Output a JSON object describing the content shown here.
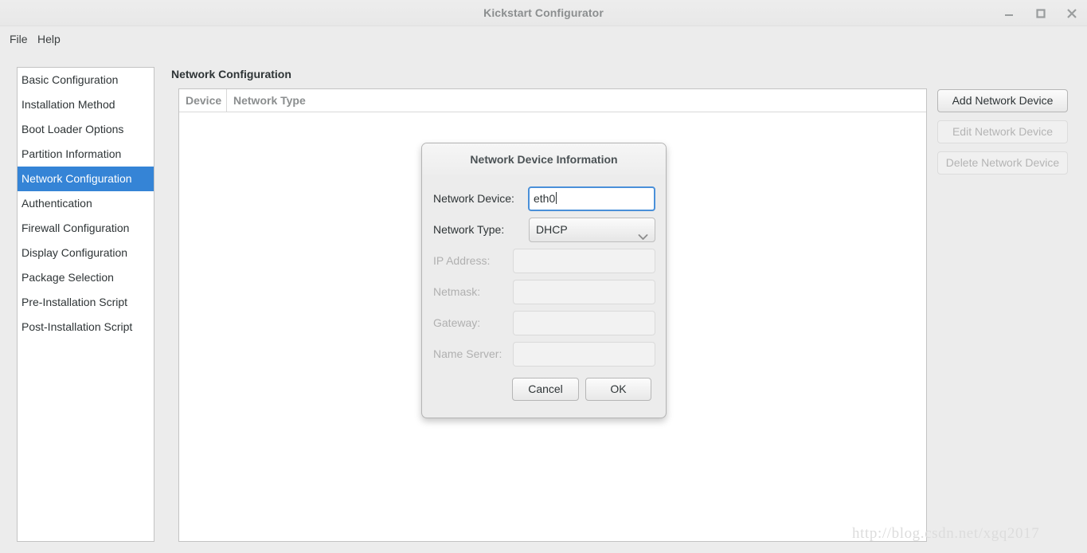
{
  "window": {
    "title": "Kickstart Configurator",
    "controls": {
      "minimize": "minimize-icon",
      "maximize": "maximize-icon",
      "close": "close-icon"
    }
  },
  "menubar": {
    "items": [
      {
        "label": "File"
      },
      {
        "label": "Help"
      }
    ]
  },
  "sidebar": {
    "items": [
      {
        "label": "Basic Configuration",
        "selected": false
      },
      {
        "label": "Installation Method",
        "selected": false
      },
      {
        "label": "Boot Loader Options",
        "selected": false
      },
      {
        "label": "Partition Information",
        "selected": false
      },
      {
        "label": "Network Configuration",
        "selected": true
      },
      {
        "label": "Authentication",
        "selected": false
      },
      {
        "label": "Firewall Configuration",
        "selected": false
      },
      {
        "label": "Display Configuration",
        "selected": false
      },
      {
        "label": "Package Selection",
        "selected": false
      },
      {
        "label": "Pre-Installation Script",
        "selected": false
      },
      {
        "label": "Post-Installation Script",
        "selected": false
      }
    ],
    "selected_label": "Network Configuration"
  },
  "main": {
    "title": "Network Configuration",
    "table": {
      "columns": [
        "Device",
        "Network Type"
      ],
      "rows": []
    },
    "actions": [
      {
        "label": "Add Network Device",
        "enabled": true
      },
      {
        "label": "Edit Network Device",
        "enabled": false
      },
      {
        "label": "Delete Network Device",
        "enabled": false
      }
    ]
  },
  "dialog": {
    "title": "Network Device Information",
    "fields": [
      {
        "label": "Network Device:",
        "value": "eth0",
        "placeholder": "",
        "enabled": true,
        "focused": true,
        "type": "text"
      },
      {
        "label": "Network Type:",
        "value": "DHCP",
        "enabled": true,
        "focused": false,
        "type": "select"
      },
      {
        "label": "IP Address:",
        "value": "",
        "placeholder": "",
        "enabled": false,
        "focused": false,
        "type": "text"
      },
      {
        "label": "Netmask:",
        "value": "",
        "placeholder": "",
        "enabled": false,
        "focused": false,
        "type": "text"
      },
      {
        "label": "Gateway:",
        "value": "",
        "placeholder": "",
        "enabled": false,
        "focused": false,
        "type": "text"
      },
      {
        "label": "Name Server:",
        "value": "",
        "placeholder": "",
        "enabled": false,
        "focused": false,
        "type": "text"
      }
    ],
    "buttons": {
      "cancel": "Cancel",
      "ok": "OK"
    }
  },
  "watermark": {
    "text": "http://blog.csdn.net/xgq2017"
  },
  "colors": {
    "accent": "#3584d6",
    "focus_border": "#4a90d9",
    "window_bg": "#ececec",
    "panel_bg": "#ffffff",
    "disabled_text": "#b0b0b0",
    "title_text": "#8b8e8f"
  }
}
